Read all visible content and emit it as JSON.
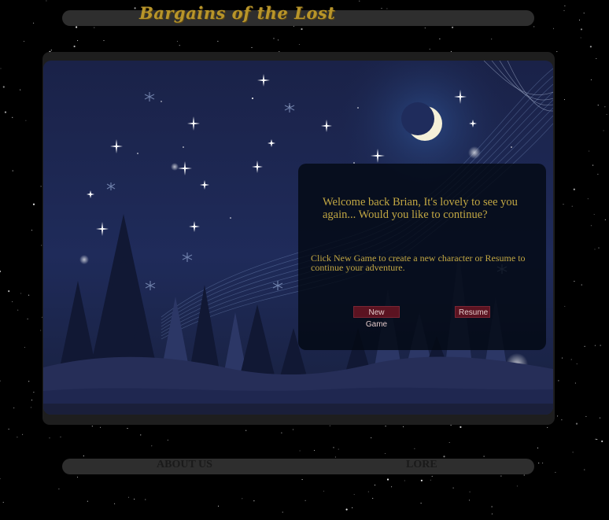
{
  "header": {
    "logo_text": "Bargains of the Lost"
  },
  "dialog": {
    "welcome_text": "Welcome back Brian, It's lovely to see you again... Would you like to continue?",
    "instructions_text": "Click New Game to create a new character or Resume to continue your adventure.",
    "new_game_label": "New Game",
    "resume_label": "Resume"
  },
  "footer_nav": {
    "about_label": "ABOUT US",
    "lore_label": "LORE"
  },
  "colors": {
    "accent_gold": "#c2a743",
    "button_maroon": "#5b1321",
    "bar_gray": "#2e2e2e",
    "scene_navy": "#1b2550"
  },
  "icons": [
    "logo-wordmark",
    "crescent-moon-icon",
    "star-icon",
    "snowflake-icon",
    "pine-tree-icon"
  ]
}
